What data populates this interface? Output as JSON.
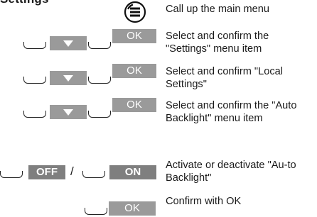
{
  "page": {
    "heading_fragment": "Settings"
  },
  "steps": [
    {
      "keys": {
        "icon": "menu-icon"
      },
      "text": "Call up the main menu"
    },
    {
      "keys": {
        "ok_label": "OK"
      },
      "text": "Select and confirm the \"Settings\" menu item"
    },
    {
      "keys": {
        "ok_label": "OK"
      },
      "text": "Select and confirm \"Local Settings\""
    },
    {
      "keys": {
        "ok_label": "OK"
      },
      "text": "Select and confirm the \"Auto Backlight\" menu item"
    },
    {
      "keys": {
        "off_label": "OFF",
        "separator": "/",
        "on_label": "ON"
      },
      "text": "Activate or deactivate \"Au-to Backlight\""
    },
    {
      "keys": {
        "ok_label": "OK"
      },
      "text": "Confirm with OK"
    }
  ]
}
